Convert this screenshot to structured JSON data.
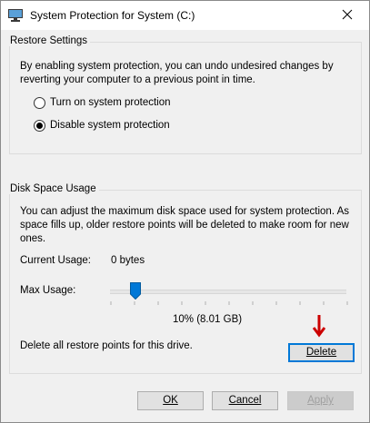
{
  "window": {
    "title": "System Protection for System (C:)"
  },
  "restore_settings": {
    "legend": "Restore Settings",
    "description_line1": "By enabling system protection, you can undo undesired changes by",
    "description_line2": "reverting your computer to a previous point in time.",
    "options": [
      {
        "label": "Turn on system protection",
        "selected": false
      },
      {
        "label": "Disable system protection",
        "selected": true
      }
    ]
  },
  "disk_space": {
    "legend": "Disk Space Usage",
    "description_line1": "You can adjust the maximum disk space used for system protection. As",
    "description_line2": "space fills up, older restore points will be deleted to make room for new",
    "description_line3": "ones.",
    "current_usage_label": "Current Usage:",
    "current_usage_value": "0 bytes",
    "max_usage_label": "Max Usage:",
    "max_usage_fraction": 0.1,
    "max_usage_value": "10% (8.01 GB)",
    "delete_text": "Delete all restore points for this drive.",
    "delete_button": "Delete"
  },
  "buttons": {
    "ok": "OK",
    "cancel": "Cancel",
    "apply": "Apply"
  },
  "colors": {
    "accent": "#0078d7",
    "arrow": "#cc0000"
  },
  "icons": {
    "app": "system-protection-icon",
    "close": "close-icon",
    "annotation": "red-down-arrow-icon"
  }
}
